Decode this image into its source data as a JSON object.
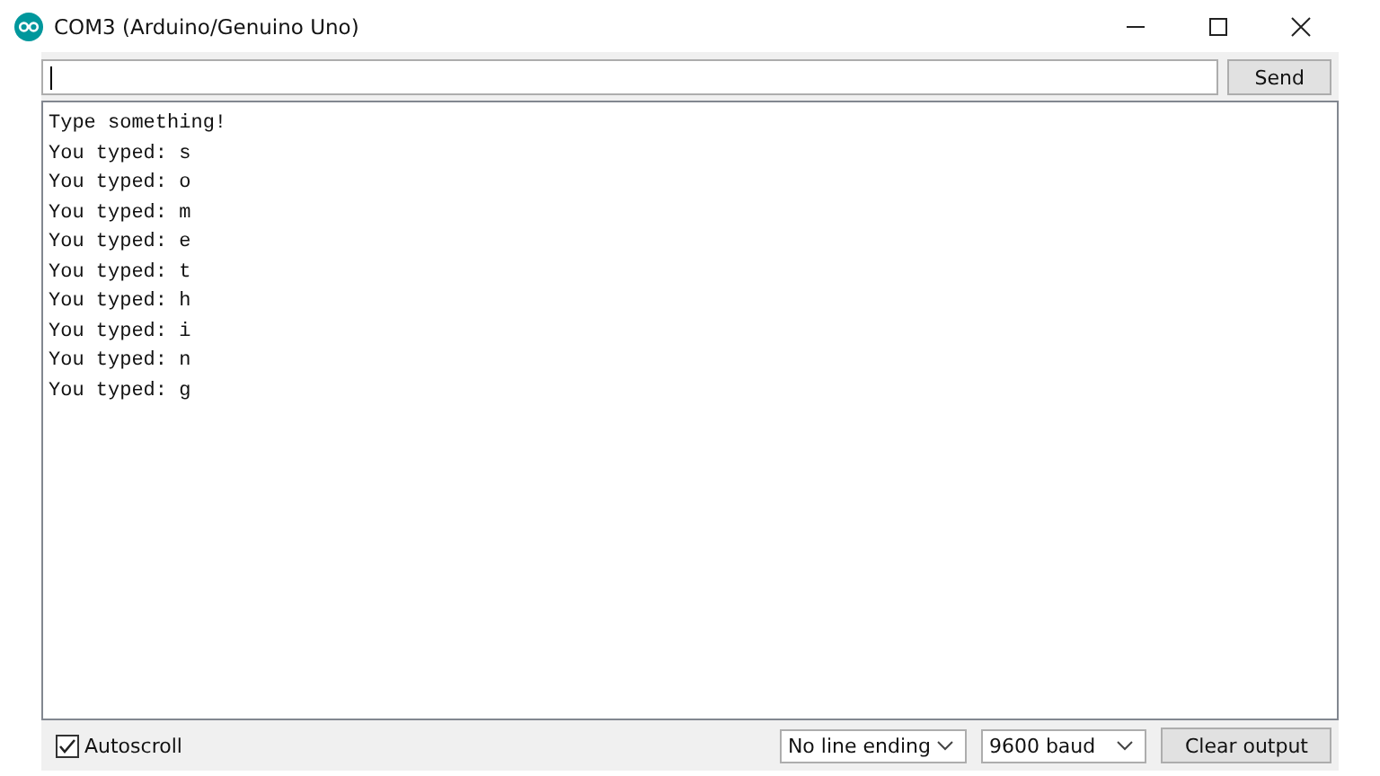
{
  "window": {
    "title": "COM3 (Arduino/Genuino Uno)"
  },
  "input": {
    "send_label": "Send"
  },
  "output": {
    "lines": [
      "Type something!",
      "You typed: s",
      "You typed: o",
      "You typed: m",
      "You typed: e",
      "You typed: t",
      "You typed: h",
      "You typed: i",
      "You typed: n",
      "You typed: g"
    ]
  },
  "footer": {
    "autoscroll": {
      "label": "Autoscroll",
      "checked": true
    },
    "line_ending": "No line ending",
    "baud": "9600 baud",
    "clear_label": "Clear output"
  }
}
